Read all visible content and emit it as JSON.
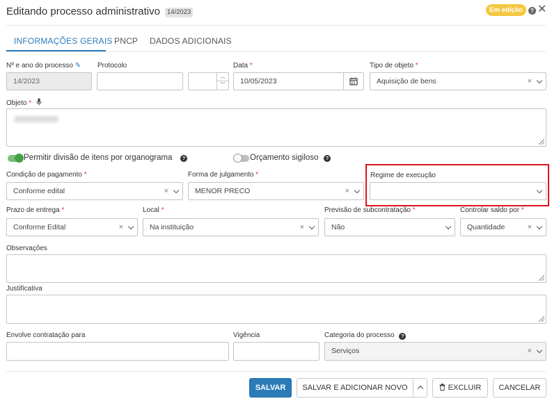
{
  "header": {
    "title": "Editando processo administrativo",
    "process_number_badge": "14/2023",
    "status": "Em edição",
    "status_color": "#f5c842",
    "help_icon": "question-circle-icon",
    "close_icon": "close-icon"
  },
  "tabs": [
    {
      "label": "INFORMAÇÕES GERAIS",
      "active": true
    },
    {
      "label": "PNCP",
      "active": false
    },
    {
      "label": "DADOS ADICIONAIS",
      "active": false
    }
  ],
  "fields": {
    "numero_ano": {
      "label": "Nº e ano do processo",
      "value": "14/2023"
    },
    "protocolo": {
      "label": "Protocolo",
      "value": ""
    },
    "data": {
      "label": "Data",
      "value": "10/05/2023"
    },
    "tipo_objeto": {
      "label": "Tipo de objeto",
      "value": "Aquisição de bens"
    },
    "objeto": {
      "label": "Objeto",
      "value": "",
      "mic_icon": "microphone-icon"
    },
    "permitir_divisao": {
      "label": "Permitir divisão de itens por organograma",
      "enabled": true
    },
    "orcamento_sigiloso": {
      "label": "Orçamento sigiloso",
      "enabled": false
    },
    "condicao_pagamento": {
      "label": "Condição de pagamento",
      "value": "Conforme edital"
    },
    "forma_julgamento": {
      "label": "Forma de julgamento",
      "value": "MENOR PRECO"
    },
    "regime_execucao": {
      "label": "Regime de execução",
      "value": ""
    },
    "prazo_entrega": {
      "label": "Prazo de entrega",
      "value": "Conforme Edital"
    },
    "local": {
      "label": "Local",
      "value": "Na instituição"
    },
    "previsao_subcontratacao": {
      "label": "Previsão de subcontratação",
      "value": "Não"
    },
    "controlar_saldo": {
      "label": "Controlar saldo por",
      "value": "Quantidade"
    },
    "observacoes": {
      "label": "Observações",
      "value": ""
    },
    "justificativa": {
      "label": "Justificativa",
      "value": ""
    },
    "envolve_contratacao": {
      "label": "Envolve contratação para",
      "value": ""
    },
    "vigencia": {
      "label": "Vigência",
      "value": ""
    },
    "categoria_processo": {
      "label": "Categoria do processo",
      "value": "Serviços"
    }
  },
  "required_marker": "*",
  "clear_glyph": "×",
  "footer": {
    "save": "SALVAR",
    "save_add": "SALVAR E ADICIONAR NOVO",
    "delete": "EXCLUIR",
    "cancel": "CANCELAR",
    "primary_color": "#2b7bb9",
    "highlight_color": "#d9141b"
  }
}
